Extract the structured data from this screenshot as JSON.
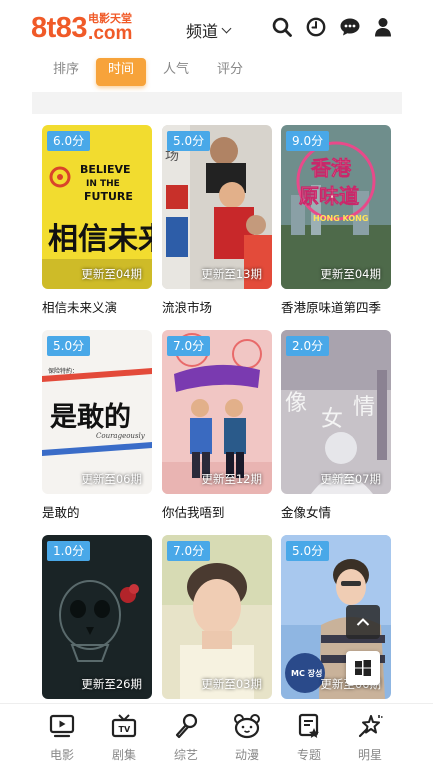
{
  "header": {
    "logo_main": "8t83",
    "logo_cn": "电影天堂",
    "logo_com": ".com",
    "channel_label": "频道"
  },
  "filters": [
    {
      "label": "排序",
      "active": false
    },
    {
      "label": "时间",
      "active": true
    },
    {
      "label": "人气",
      "active": false
    },
    {
      "label": "评分",
      "active": false
    }
  ],
  "items": [
    {
      "title": "相信未来义演",
      "score": "6.0分",
      "update": "更新至04期",
      "poster_text": [
        "BELIEVE",
        "IN THE",
        "FUTURE",
        "相信未来"
      ]
    },
    {
      "title": "流浪市场",
      "score": "5.0分",
      "update": "更新至13期",
      "poster_text": [
        "场"
      ]
    },
    {
      "title": "香港原味道第四季",
      "score": "9.0分",
      "update": "更新至04期",
      "poster_text": [
        "香港",
        "原味道",
        "HONG KONG"
      ]
    },
    {
      "title": "是敢的",
      "score": "5.0分",
      "update": "更新至06期",
      "poster_text": [
        "保险特約：",
        "是敢的",
        "Courageously"
      ]
    },
    {
      "title": "你估我唔到",
      "score": "7.0分",
      "update": "更新至12期",
      "poster_text": []
    },
    {
      "title": "金像女情",
      "score": "2.0分",
      "update": "更新至07期",
      "poster_text": [
        "像",
        "女",
        "情"
      ]
    },
    {
      "title": "",
      "score": "1.0分",
      "update": "更新至26期",
      "poster_text": []
    },
    {
      "title": "",
      "score": "7.0分",
      "update": "更新至03期",
      "poster_text": []
    },
    {
      "title": "",
      "score": "5.0分",
      "update": "更新至06期",
      "poster_text": [
        "MC 장성"
      ]
    }
  ],
  "bottom_nav": [
    {
      "label": "电影",
      "icon": "movie-icon"
    },
    {
      "label": "剧集",
      "icon": "tv-icon"
    },
    {
      "label": "综艺",
      "icon": "microphone-icon"
    },
    {
      "label": "动漫",
      "icon": "bear-icon"
    },
    {
      "label": "专题",
      "icon": "topic-icon"
    },
    {
      "label": "明星",
      "icon": "star-wand-icon"
    }
  ],
  "colors": {
    "brand": "#f05a28",
    "accent": "#f7a33a",
    "score_badge": "#49a8e8"
  }
}
